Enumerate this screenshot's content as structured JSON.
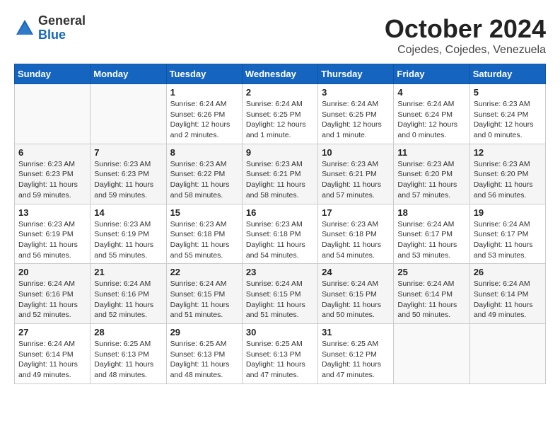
{
  "header": {
    "logo_general": "General",
    "logo_blue": "Blue",
    "month": "October 2024",
    "location": "Cojedes, Cojedes, Venezuela"
  },
  "days_of_week": [
    "Sunday",
    "Monday",
    "Tuesday",
    "Wednesday",
    "Thursday",
    "Friday",
    "Saturday"
  ],
  "weeks": [
    [
      {
        "day": "",
        "info": ""
      },
      {
        "day": "",
        "info": ""
      },
      {
        "day": "1",
        "info": "Sunrise: 6:24 AM\nSunset: 6:26 PM\nDaylight: 12 hours\nand 2 minutes."
      },
      {
        "day": "2",
        "info": "Sunrise: 6:24 AM\nSunset: 6:25 PM\nDaylight: 12 hours\nand 1 minute."
      },
      {
        "day": "3",
        "info": "Sunrise: 6:24 AM\nSunset: 6:25 PM\nDaylight: 12 hours\nand 1 minute."
      },
      {
        "day": "4",
        "info": "Sunrise: 6:24 AM\nSunset: 6:24 PM\nDaylight: 12 hours\nand 0 minutes."
      },
      {
        "day": "5",
        "info": "Sunrise: 6:23 AM\nSunset: 6:24 PM\nDaylight: 12 hours\nand 0 minutes."
      }
    ],
    [
      {
        "day": "6",
        "info": "Sunrise: 6:23 AM\nSunset: 6:23 PM\nDaylight: 11 hours\nand 59 minutes."
      },
      {
        "day": "7",
        "info": "Sunrise: 6:23 AM\nSunset: 6:23 PM\nDaylight: 11 hours\nand 59 minutes."
      },
      {
        "day": "8",
        "info": "Sunrise: 6:23 AM\nSunset: 6:22 PM\nDaylight: 11 hours\nand 58 minutes."
      },
      {
        "day": "9",
        "info": "Sunrise: 6:23 AM\nSunset: 6:21 PM\nDaylight: 11 hours\nand 58 minutes."
      },
      {
        "day": "10",
        "info": "Sunrise: 6:23 AM\nSunset: 6:21 PM\nDaylight: 11 hours\nand 57 minutes."
      },
      {
        "day": "11",
        "info": "Sunrise: 6:23 AM\nSunset: 6:20 PM\nDaylight: 11 hours\nand 57 minutes."
      },
      {
        "day": "12",
        "info": "Sunrise: 6:23 AM\nSunset: 6:20 PM\nDaylight: 11 hours\nand 56 minutes."
      }
    ],
    [
      {
        "day": "13",
        "info": "Sunrise: 6:23 AM\nSunset: 6:19 PM\nDaylight: 11 hours\nand 56 minutes."
      },
      {
        "day": "14",
        "info": "Sunrise: 6:23 AM\nSunset: 6:19 PM\nDaylight: 11 hours\nand 55 minutes."
      },
      {
        "day": "15",
        "info": "Sunrise: 6:23 AM\nSunset: 6:18 PM\nDaylight: 11 hours\nand 55 minutes."
      },
      {
        "day": "16",
        "info": "Sunrise: 6:23 AM\nSunset: 6:18 PM\nDaylight: 11 hours\nand 54 minutes."
      },
      {
        "day": "17",
        "info": "Sunrise: 6:23 AM\nSunset: 6:18 PM\nDaylight: 11 hours\nand 54 minutes."
      },
      {
        "day": "18",
        "info": "Sunrise: 6:24 AM\nSunset: 6:17 PM\nDaylight: 11 hours\nand 53 minutes."
      },
      {
        "day": "19",
        "info": "Sunrise: 6:24 AM\nSunset: 6:17 PM\nDaylight: 11 hours\nand 53 minutes."
      }
    ],
    [
      {
        "day": "20",
        "info": "Sunrise: 6:24 AM\nSunset: 6:16 PM\nDaylight: 11 hours\nand 52 minutes."
      },
      {
        "day": "21",
        "info": "Sunrise: 6:24 AM\nSunset: 6:16 PM\nDaylight: 11 hours\nand 52 minutes."
      },
      {
        "day": "22",
        "info": "Sunrise: 6:24 AM\nSunset: 6:15 PM\nDaylight: 11 hours\nand 51 minutes."
      },
      {
        "day": "23",
        "info": "Sunrise: 6:24 AM\nSunset: 6:15 PM\nDaylight: 11 hours\nand 51 minutes."
      },
      {
        "day": "24",
        "info": "Sunrise: 6:24 AM\nSunset: 6:15 PM\nDaylight: 11 hours\nand 50 minutes."
      },
      {
        "day": "25",
        "info": "Sunrise: 6:24 AM\nSunset: 6:14 PM\nDaylight: 11 hours\nand 50 minutes."
      },
      {
        "day": "26",
        "info": "Sunrise: 6:24 AM\nSunset: 6:14 PM\nDaylight: 11 hours\nand 49 minutes."
      }
    ],
    [
      {
        "day": "27",
        "info": "Sunrise: 6:24 AM\nSunset: 6:14 PM\nDaylight: 11 hours\nand 49 minutes."
      },
      {
        "day": "28",
        "info": "Sunrise: 6:25 AM\nSunset: 6:13 PM\nDaylight: 11 hours\nand 48 minutes."
      },
      {
        "day": "29",
        "info": "Sunrise: 6:25 AM\nSunset: 6:13 PM\nDaylight: 11 hours\nand 48 minutes."
      },
      {
        "day": "30",
        "info": "Sunrise: 6:25 AM\nSunset: 6:13 PM\nDaylight: 11 hours\nand 47 minutes."
      },
      {
        "day": "31",
        "info": "Sunrise: 6:25 AM\nSunset: 6:12 PM\nDaylight: 11 hours\nand 47 minutes."
      },
      {
        "day": "",
        "info": ""
      },
      {
        "day": "",
        "info": ""
      }
    ]
  ]
}
